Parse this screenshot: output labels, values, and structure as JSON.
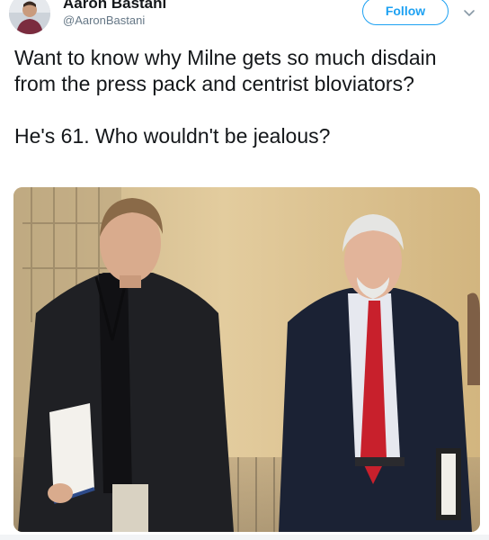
{
  "tweet": {
    "author": {
      "display_name": "Aaron Bastani",
      "handle": "@AaronBastani",
      "avatar_icon": "profile-photo"
    },
    "follow_label": "Follow",
    "menu_icon": "chevron-down-icon",
    "text_lines": [
      "Want to know why Milne gets so much disdain from the press pack and centrist bloviators?",
      "He's 61. Who wouldn't be jealous?"
    ],
    "media": {
      "kind": "photo",
      "description_icon": "photo-two-men-walking"
    }
  },
  "colors": {
    "accent": "#1da1f2",
    "text_primary": "#14171a",
    "text_secondary": "#657786"
  }
}
